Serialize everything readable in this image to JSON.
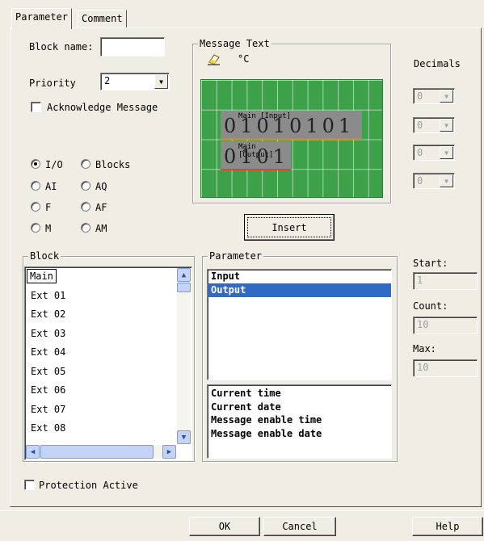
{
  "tabs": [
    {
      "label": "Parameter"
    },
    {
      "label": "Comment"
    }
  ],
  "block_name": {
    "label": "Block name:",
    "value": ""
  },
  "priority": {
    "label": "Priority",
    "value": "2"
  },
  "acknowledge": {
    "label": "Acknowledge Message",
    "checked": false
  },
  "radios": [
    {
      "label": "I/O",
      "selected": true
    },
    {
      "label": "Blocks",
      "selected": false
    },
    {
      "label": "AI",
      "selected": false
    },
    {
      "label": "AQ",
      "selected": false
    },
    {
      "label": "F",
      "selected": false
    },
    {
      "label": "AF",
      "selected": false
    },
    {
      "label": "M",
      "selected": false
    },
    {
      "label": "AM",
      "selected": false
    }
  ],
  "message_text": {
    "title": "Message Text",
    "degree": "°C",
    "block1_tag": "Main [Input]",
    "block1_digits": "01010101",
    "block2_tag": "Main [Output]",
    "block2_digits": "0101"
  },
  "decimals": {
    "label": "Decimals",
    "values": [
      "0",
      "0",
      "0",
      "0"
    ]
  },
  "insert_button": "Insert",
  "block_group": {
    "title": "Block",
    "items": [
      "Main",
      "Ext 01",
      "Ext 02",
      "Ext 03",
      "Ext 04",
      "Ext 05",
      "Ext 06",
      "Ext 07",
      "Ext 08"
    ],
    "selected": "Main"
  },
  "parameter_group": {
    "title": "Parameter",
    "items": [
      "Input",
      "Output"
    ],
    "selected": "Output",
    "extra_items": [
      "Current time",
      "Current date",
      "Message enable time",
      "Message enable date"
    ]
  },
  "start": {
    "label": "Start:",
    "value": "1"
  },
  "count": {
    "label": "Count:",
    "value": "10"
  },
  "max": {
    "label": "Max:",
    "value": "10"
  },
  "protection": {
    "label": "Protection Active",
    "checked": false
  },
  "footer": {
    "ok": "OK",
    "cancel": "Cancel",
    "help": "Help"
  },
  "colors": {
    "canvas_green": "#3da14a",
    "selection_blue": "#316ac5",
    "message_block_gray": "#8b8b8b"
  }
}
